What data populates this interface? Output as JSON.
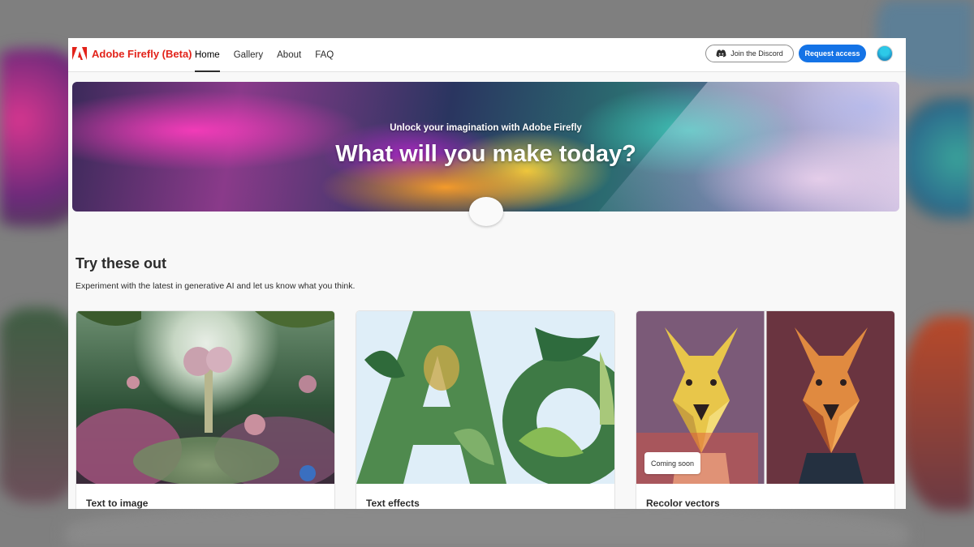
{
  "header": {
    "brand_name": "Adobe Firefly (Beta)",
    "nav": [
      {
        "label": "Home",
        "active": true
      },
      {
        "label": "Gallery",
        "active": false
      },
      {
        "label": "About",
        "active": false
      },
      {
        "label": "FAQ",
        "active": false
      }
    ],
    "discord_label": "Join the Discord",
    "request_label": "Request access"
  },
  "hero": {
    "subtitle": "Unlock your imagination with Adobe Firefly",
    "title": "What will you make today?"
  },
  "section": {
    "title": "Try these out",
    "description": "Experiment with the latest in generative AI and let us know what you think."
  },
  "cards": [
    {
      "title": "Text to image",
      "icon": "fantasy-garden-image"
    },
    {
      "title": "Text effects",
      "icon": "leaf-letters-image"
    },
    {
      "title": "Recolor vectors",
      "icon": "dog-vector-image",
      "badge": "Coming soon"
    }
  ],
  "colors": {
    "brand": "#e2231a",
    "primary_button": "#1473e6",
    "text": "#2c2c2c",
    "page_bg": "#f8f8f8"
  }
}
